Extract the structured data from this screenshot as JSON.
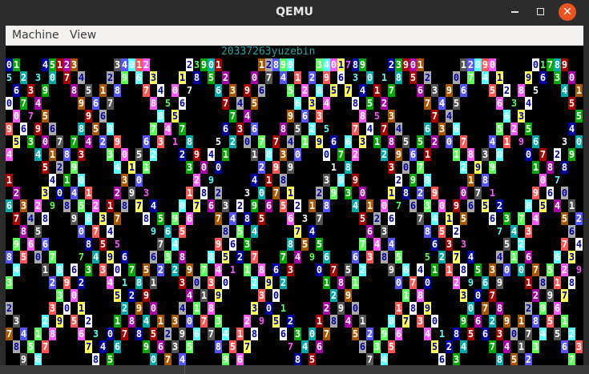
{
  "window": {
    "title": "QEMU",
    "controls": {
      "minimize_icon": "minimize-icon",
      "maximize_icon": "maximize-icon",
      "close_icon": "close-icon",
      "close_glyph": "✕"
    }
  },
  "menu": {
    "items": [
      "Machine",
      "View"
    ]
  },
  "screen": {
    "header_text": "20337263yuzebin",
    "header_color": "#1fa6a6",
    "palette": {
      "b": "#0000aa",
      "g": "#00aa00",
      "c": "#00aaaa",
      "r": "#aa0000",
      "m": "#aa00aa",
      "y": "#aa5500",
      "l": "#aaaaaa",
      "d": "#555555",
      "B": "#5555ff",
      "G": "#55ff55",
      "C": "#55ffff",
      "R": "#ff5555",
      "M": "#ff55ff",
      "Y": "#ffff55",
      "W": "#ffffff",
      "k": "#000000"
    },
    "cells": [
      [
        "0",
        "M",
        "k",
        0,
        9
      ],
      [
        "9",
        "l",
        "k",
        1,
        11
      ],
      [
        "5",
        "R",
        "k",
        2,
        8
      ],
      [
        "2",
        "r",
        "k",
        4,
        13
      ],
      [
        "1",
        "W",
        "k",
        1,
        28
      ],
      [
        "2",
        "B",
        "k",
        4,
        39
      ],
      [
        "8",
        "C",
        "k",
        1,
        35
      ],
      [
        "3",
        "m",
        "k",
        3,
        39
      ],
      [
        "1",
        "G",
        "k",
        5,
        42
      ],
      [
        "4",
        "R",
        "k",
        6,
        41
      ],
      [
        "6",
        "C",
        "k",
        3,
        47
      ],
      [
        "0",
        "b",
        "k",
        4,
        50
      ],
      [
        "7",
        "G",
        "k",
        6,
        56
      ],
      [
        "8",
        "R",
        "k",
        7,
        68
      ],
      [
        "0",
        "B",
        "k",
        6,
        69
      ],
      [
        "3",
        "d",
        "k",
        3,
        74
      ],
      [
        "9",
        "C",
        "k",
        4,
        76
      ],
      [
        "4",
        "W",
        "k",
        5,
        65
      ],
      [
        "6",
        "b",
        "k",
        4,
        64
      ],
      [
        "2",
        "c",
        "k",
        2,
        57
      ],
      [
        "0",
        "b",
        "k",
        0,
        0
      ],
      [
        "1",
        "W",
        "b",
        1,
        1
      ],
      [
        "2",
        "W",
        "g",
        2,
        2
      ],
      [
        "3",
        "W",
        "c",
        3,
        2
      ],
      [
        "4",
        "W",
        "r",
        3,
        3
      ],
      [
        "5",
        "W",
        "m",
        4,
        4
      ],
      [
        "6",
        "W",
        "y",
        5,
        5
      ],
      [
        "7",
        "W",
        "l",
        6,
        6
      ],
      [
        "8",
        "W",
        "d",
        7,
        7
      ],
      [
        "9",
        "W",
        "B",
        8,
        8
      ],
      [
        "7",
        "W",
        "G",
        4,
        3
      ],
      [
        "5",
        "W",
        "m",
        5,
        3
      ],
      [
        "0",
        "b",
        "k",
        36,
        41
      ],
      [
        "4",
        "W",
        "B",
        37,
        40
      ],
      [
        "5",
        "W",
        "g",
        37,
        3
      ],
      [
        "9",
        "W",
        "k",
        0,
        10
      ],
      [
        "0",
        "W",
        "C",
        1,
        12
      ],
      [
        "1",
        "W",
        "C",
        2,
        13
      ],
      [
        "2",
        "W",
        "R",
        3,
        14
      ],
      [
        "3",
        "W",
        "M",
        4,
        15
      ],
      [
        "4",
        "W",
        "Y",
        5,
        16
      ],
      [
        "5",
        "W",
        "W",
        6,
        17
      ],
      [
        "6",
        "M",
        "k",
        7,
        18
      ],
      [
        "7",
        "C",
        "k",
        8,
        19
      ],
      [
        "8",
        "W",
        "b",
        9,
        20
      ],
      [
        "9",
        "W",
        "r",
        10,
        21
      ]
    ]
  }
}
